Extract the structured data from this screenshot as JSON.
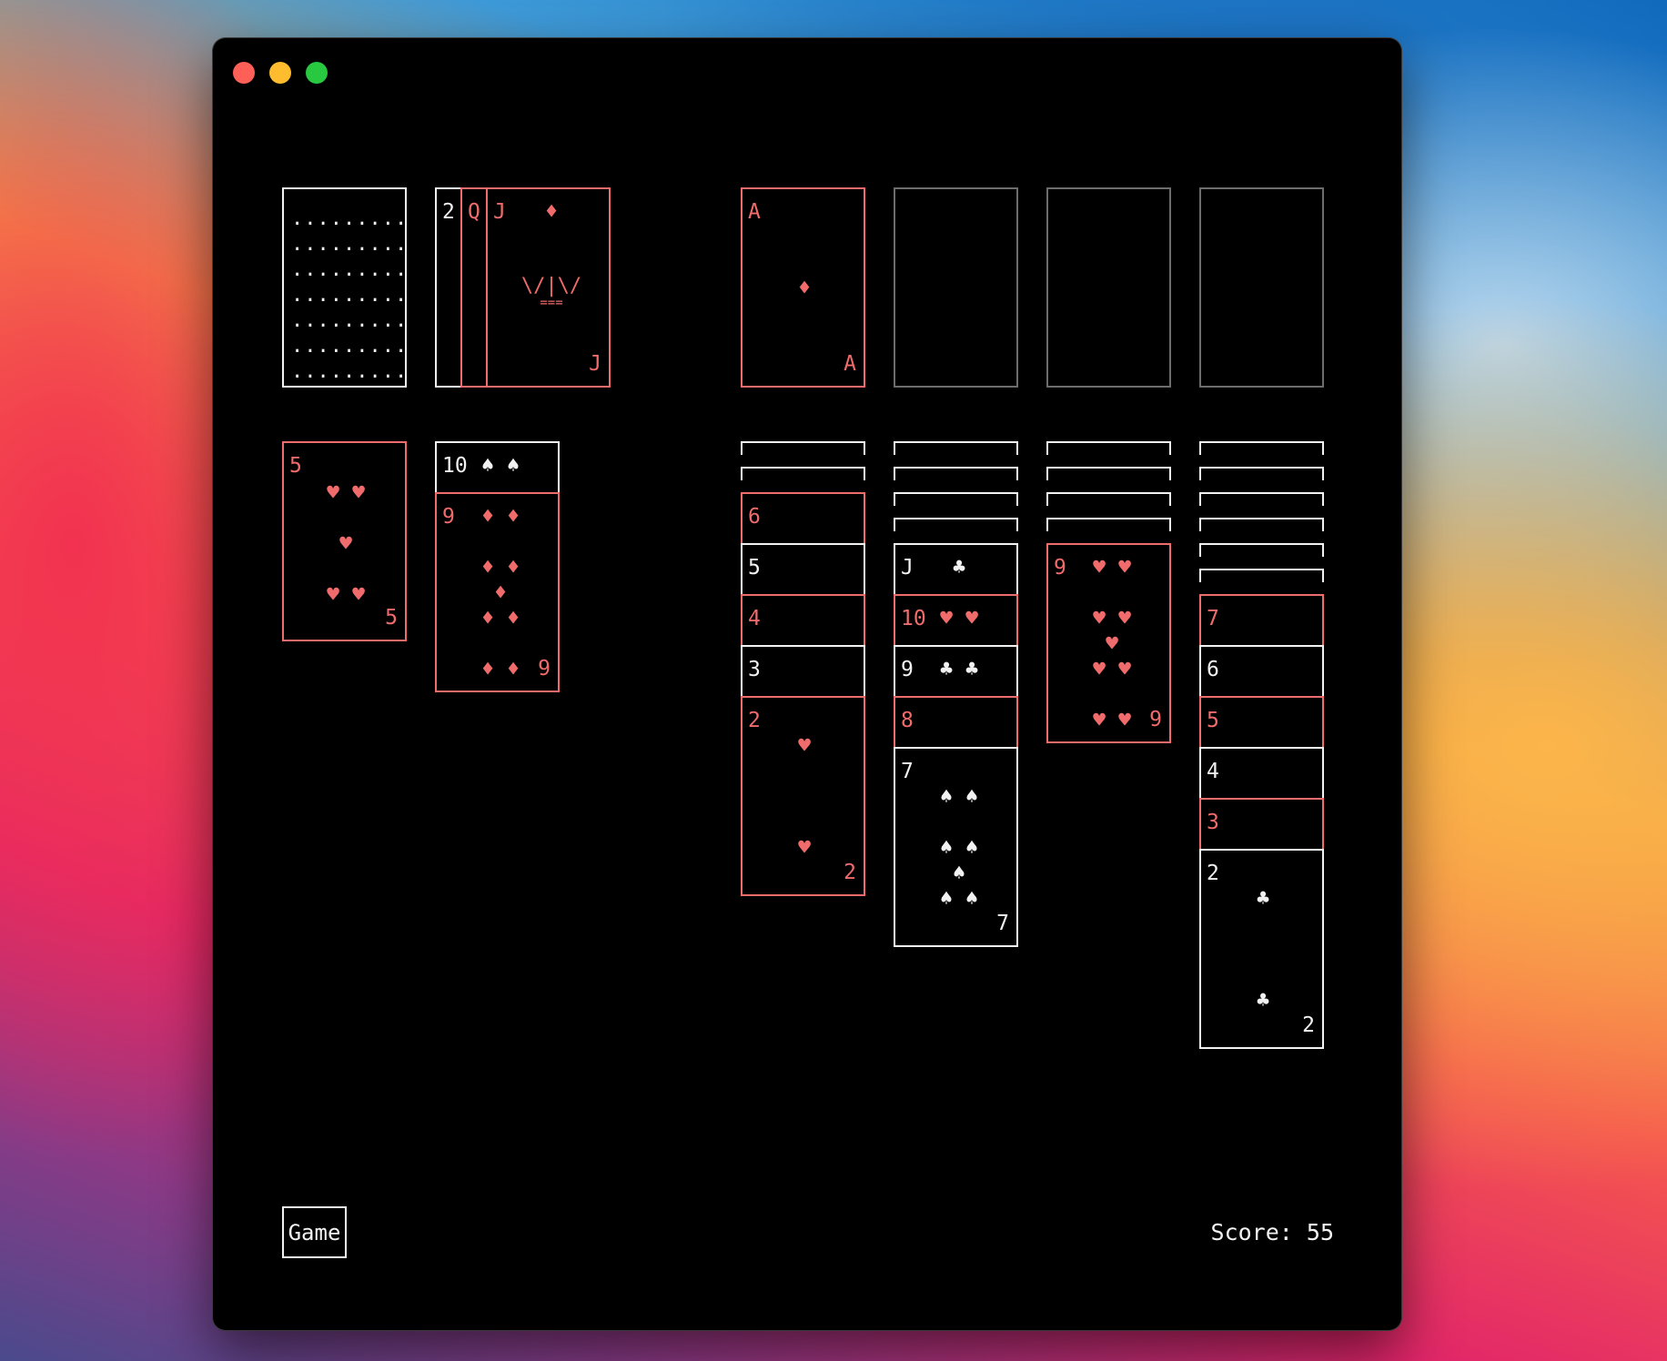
{
  "window": {
    "buttons": [
      "close",
      "minimize",
      "maximize"
    ]
  },
  "stock": {
    "pattern_row": "........."
  },
  "waste": {
    "cards": [
      {
        "rank": "2",
        "color": "black"
      },
      {
        "rank": "Q",
        "color": "red"
      },
      {
        "rank": "J",
        "suit": "♦",
        "color": "red",
        "art_line1": "\\/|\\/",
        "art_line2": "==="
      }
    ]
  },
  "foundations": [
    {
      "rank": "A",
      "suit": "♦",
      "color": "red"
    },
    {
      "empty": true
    },
    {
      "empty": true
    },
    {
      "empty": true
    }
  ],
  "tableau": {
    "col1": [
      {
        "rank": "5",
        "suit": "♥",
        "color": "red"
      }
    ],
    "col2": [
      {
        "rank": "10",
        "suit": "♠",
        "color": "black"
      },
      {
        "rank": "9",
        "suit": "♦",
        "color": "red"
      }
    ],
    "col3": [
      "hidden",
      "hidden",
      {
        "rank": "6"
      },
      {
        "rank": "5"
      },
      {
        "rank": "4"
      },
      {
        "rank": "3"
      },
      {
        "rank": "2",
        "suit": "♥"
      }
    ],
    "col4": [
      "hidden",
      "hidden",
      "hidden",
      "hidden",
      {
        "rank": "J",
        "suit": "♣"
      },
      {
        "rank": "10",
        "suit": "♥"
      },
      {
        "rank": "9",
        "suit": "♣"
      },
      {
        "rank": "8"
      },
      {
        "rank": "7",
        "suit": "♠"
      }
    ],
    "col5": [
      "hidden",
      "hidden",
      "hidden",
      "hidden",
      {
        "rank": "9",
        "suit": "♥"
      }
    ],
    "col6": [
      "hidden",
      "hidden",
      "hidden",
      "hidden",
      "hidden",
      "hidden",
      {
        "rank": "7"
      },
      {
        "rank": "6"
      },
      {
        "rank": "5"
      },
      {
        "rank": "4"
      },
      {
        "rank": "3"
      },
      {
        "rank": "2",
        "suit": "♣"
      }
    ]
  },
  "footer": {
    "game_button": "Game",
    "score_text": "Score: 55"
  },
  "colors": {
    "red": "#f06b6b",
    "white": "#f2f2f2",
    "empty_slot": "#6d6d6d",
    "background": "#000000"
  }
}
